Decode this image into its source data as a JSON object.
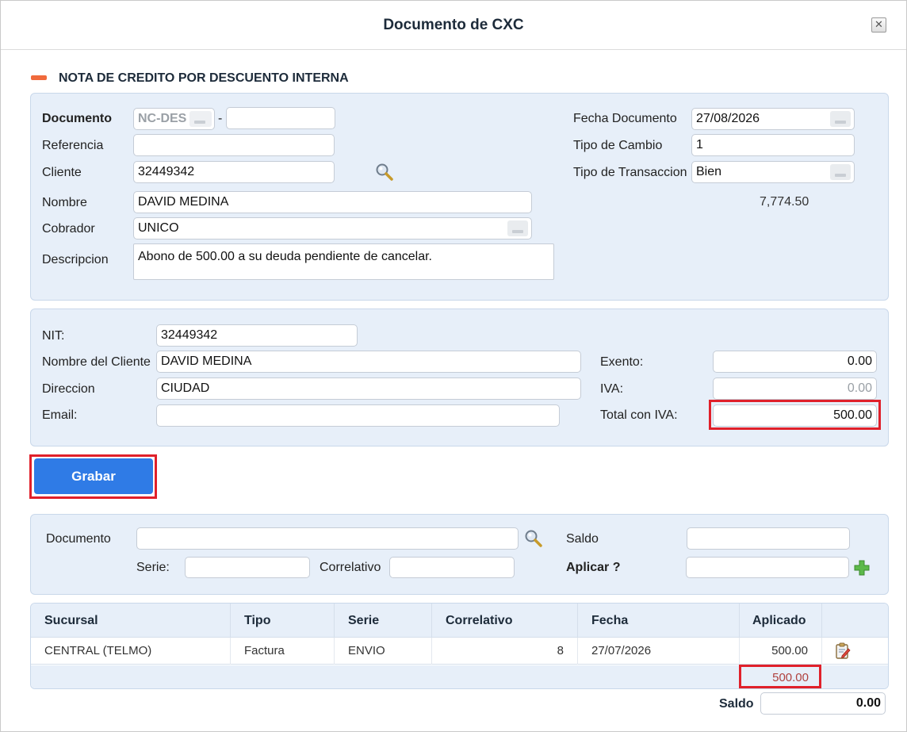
{
  "dialog": {
    "title": "Documento de CXC",
    "close_glyph": "✕"
  },
  "section": {
    "title": "NOTA DE CREDITO POR DESCUENTO INTERNA"
  },
  "header_form": {
    "documento_label": "Documento",
    "documento_prefix": "NC-DES",
    "documento_dash": "-",
    "documento_number": "",
    "referencia_label": "Referencia",
    "referencia_value": "",
    "cliente_label": "Cliente",
    "cliente_value": "32449342",
    "nombre_label": "Nombre",
    "nombre_value": "DAVID MEDINA",
    "cobrador_label": "Cobrador",
    "cobrador_value": "UNICO",
    "descripcion_label": "Descripcion",
    "descripcion_value": "Abono de 500.00 a su deuda pendiente de cancelar.",
    "fecha_label": "Fecha Documento",
    "fecha_value": "27/08/2026",
    "tipo_cambio_label": "Tipo de Cambio",
    "tipo_cambio_value": "1",
    "tipo_transaccion_label": "Tipo de Transaccion",
    "tipo_transaccion_value": "Bien",
    "balance_amount": "7,774.50"
  },
  "billing_form": {
    "nit_label": "NIT:",
    "nit_value": "32449342",
    "nombre_cliente_label": "Nombre del Cliente",
    "nombre_cliente_value": "DAVID MEDINA",
    "direccion_label": "Direccion",
    "direccion_value": "CIUDAD",
    "email_label": "Email:",
    "email_value": "",
    "exento_label": "Exento:",
    "exento_value": "0.00",
    "iva_label": "IVA:",
    "iva_value": "0.00",
    "total_label": "Total con IVA:",
    "total_value": "500.00"
  },
  "actions": {
    "save_label": "Grabar"
  },
  "apply_form": {
    "documento_label": "Documento",
    "documento_value": "",
    "serie_label": "Serie:",
    "serie_value": "",
    "correlativo_label": "Correlativo",
    "correlativo_value": "",
    "saldo_label": "Saldo",
    "saldo_value": "",
    "aplicar_label": "Aplicar ?",
    "aplicar_value": ""
  },
  "table": {
    "columns": [
      "Sucursal",
      "Tipo",
      "Serie",
      "Correlativo",
      "Fecha",
      "Aplicado"
    ],
    "rows": [
      {
        "sucursal": "CENTRAL (TELMO)",
        "tipo": "Factura",
        "serie": "ENVIO",
        "correlativo": "8",
        "fecha": "27/07/2026",
        "aplicado": "500.00"
      }
    ],
    "total_aplicado": "500.00"
  },
  "footer": {
    "saldo_label": "Saldo",
    "saldo_value": "0.00"
  },
  "colors": {
    "panel": "#e7eff9",
    "accent": "#2f7be6",
    "highlight": "#e0202a",
    "section_marker": "#f06a3c",
    "total_text": "#b0413e"
  }
}
